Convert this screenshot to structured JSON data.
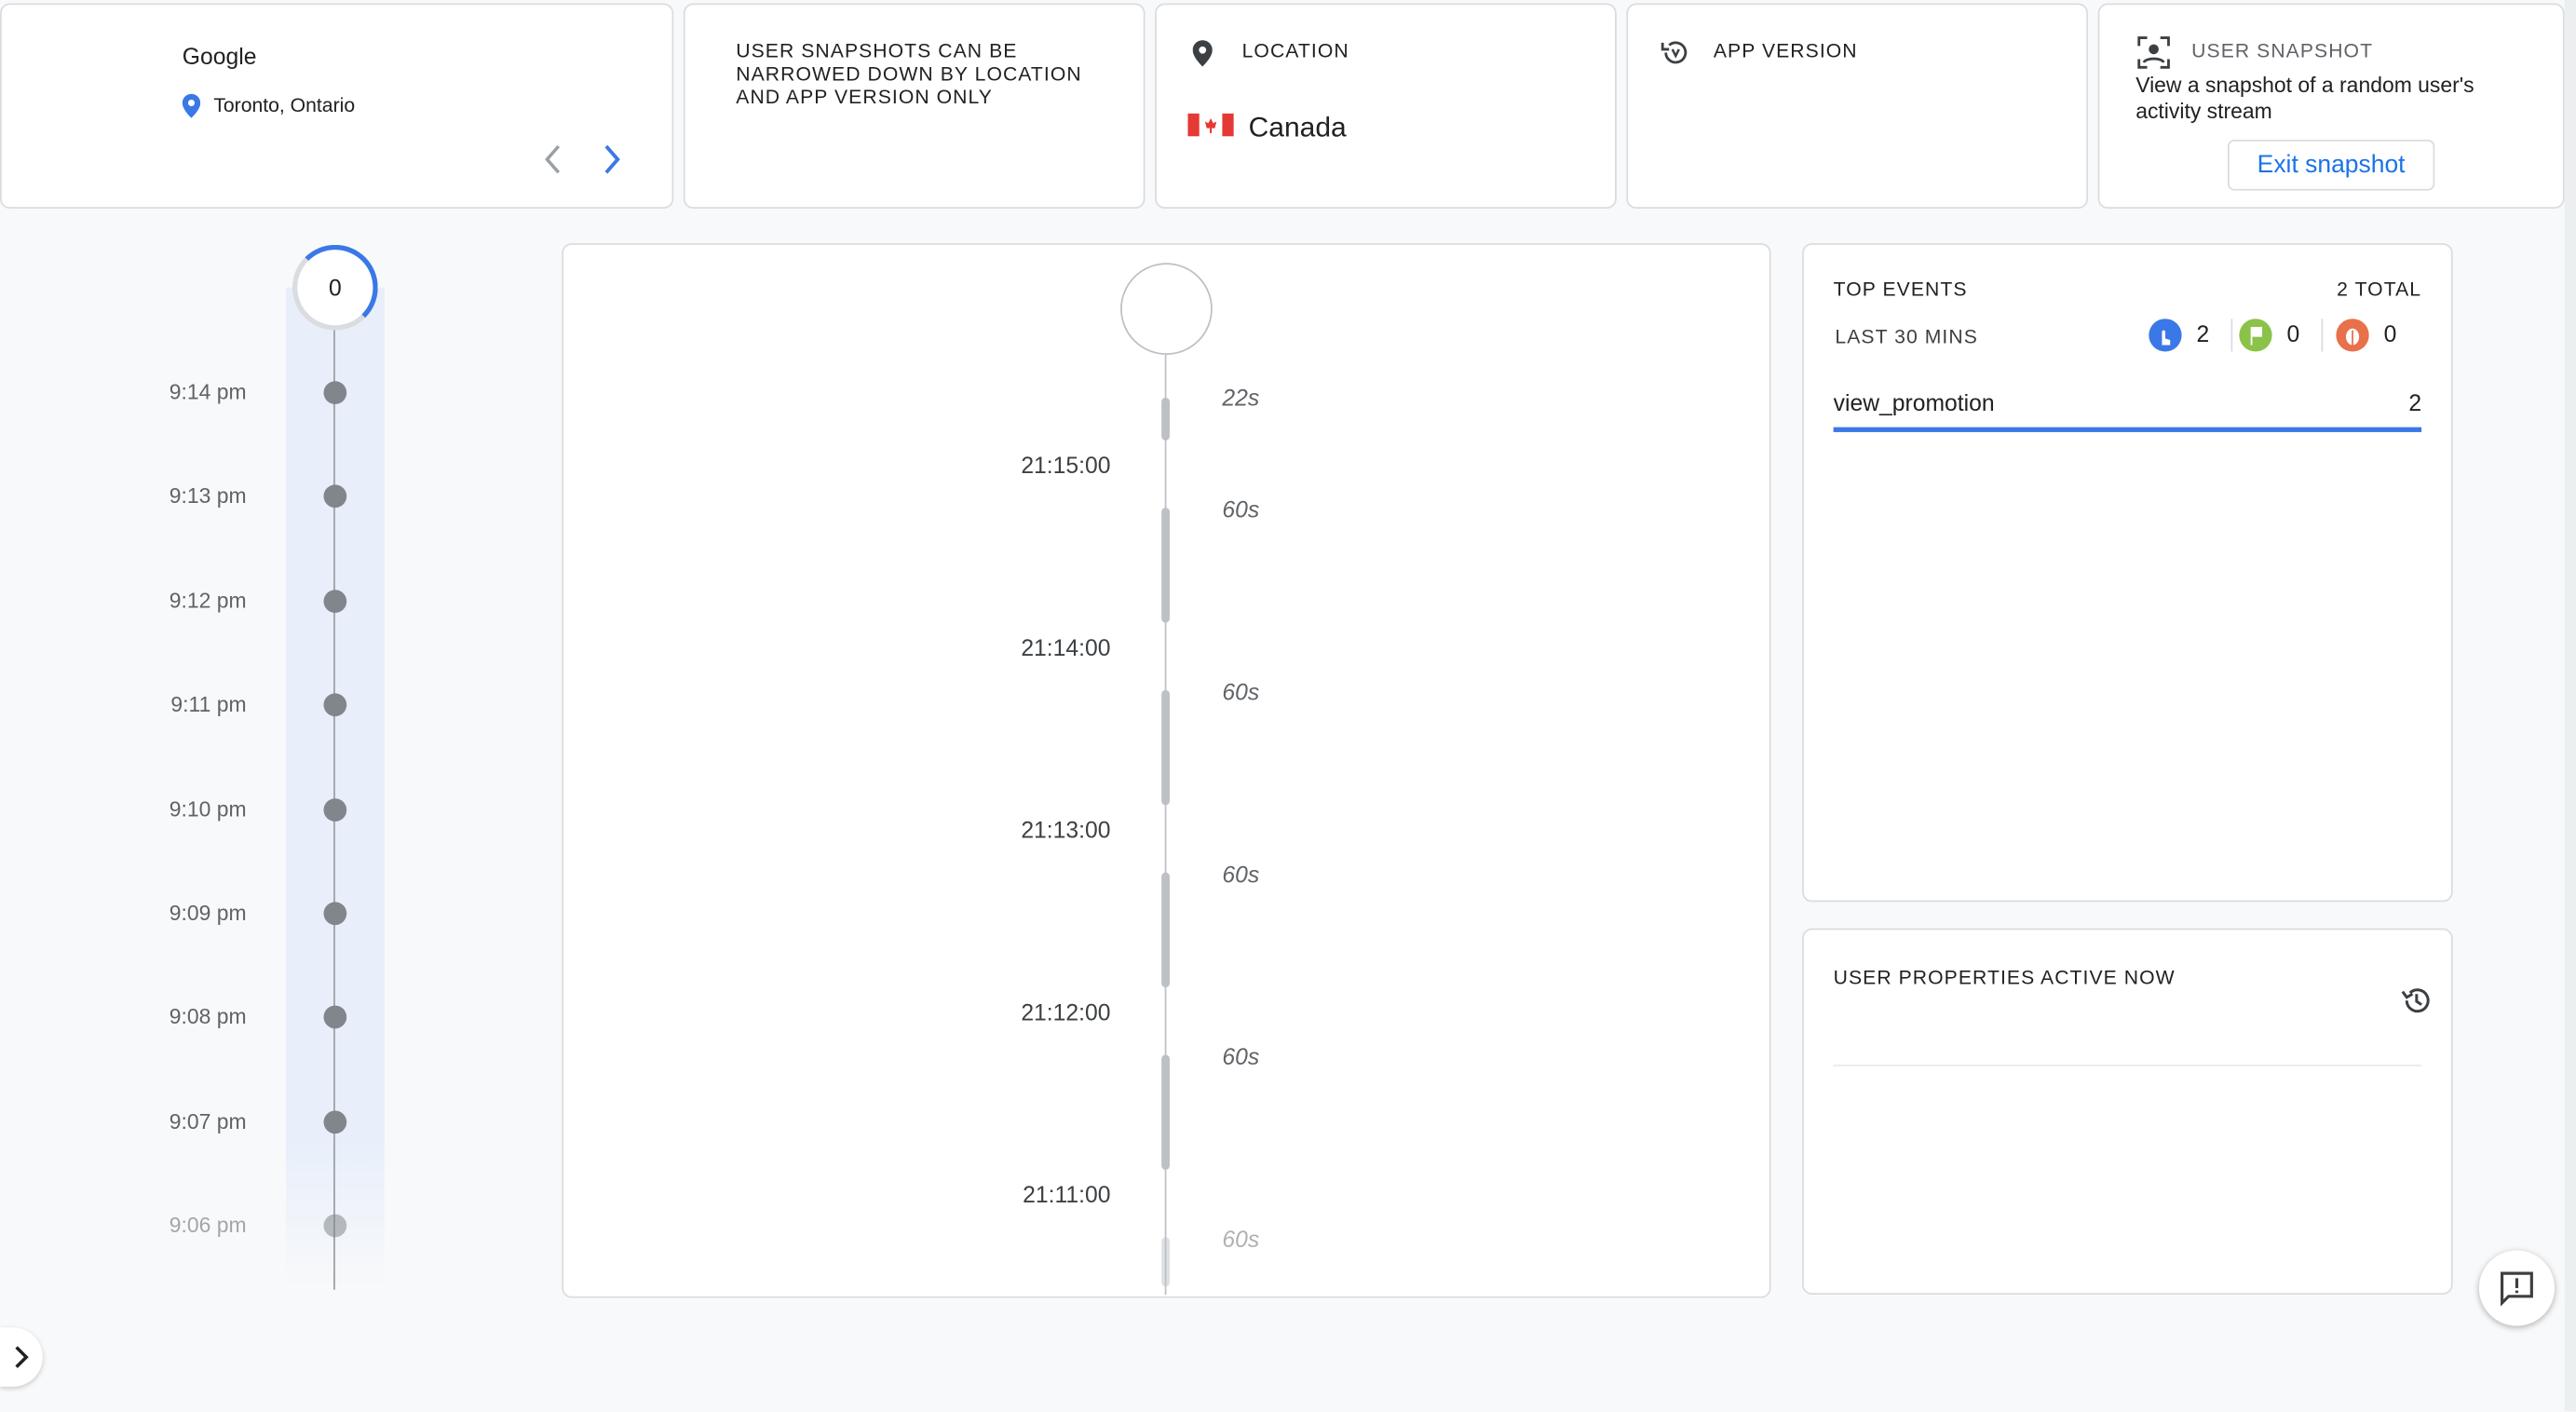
{
  "user_card": {
    "name": "Google",
    "location": "Toronto, Ontario"
  },
  "notice": {
    "text": "USER SNAPSHOTS CAN BE NARROWED DOWN BY LOCATION AND APP VERSION ONLY"
  },
  "location": {
    "label": "LOCATION",
    "value": "Canada"
  },
  "app_version": {
    "label": "APP VERSION"
  },
  "snapshot": {
    "label": "USER SNAPSHOT",
    "description": "View a snapshot of a random user's activity stream",
    "exit_label": "Exit snapshot"
  },
  "minute_timeline": {
    "counter": "0",
    "times": [
      "9:14 pm",
      "9:13 pm",
      "9:12 pm",
      "9:11 pm",
      "9:10 pm",
      "9:09 pm",
      "9:08 pm",
      "9:07 pm",
      "9:06 pm"
    ]
  },
  "stream": {
    "times": [
      "21:15:00",
      "21:14:00",
      "21:13:00",
      "21:12:00",
      "21:11:00"
    ],
    "durations": [
      "22s",
      "60s",
      "60s",
      "60s",
      "60s",
      "60s"
    ]
  },
  "top_events": {
    "title": "TOP EVENTS",
    "total": "2 TOTAL",
    "range": "LAST 30 MINS",
    "counts": [
      {
        "icon": "touch-icon",
        "color": "#3b78e7",
        "value": "2"
      },
      {
        "icon": "flag-icon",
        "color": "#8bc34a",
        "value": "0"
      },
      {
        "icon": "bug-icon",
        "color": "#e8704a",
        "value": "0"
      }
    ],
    "events": [
      {
        "name": "view_promotion",
        "count": "2"
      }
    ]
  },
  "user_properties": {
    "title": "USER PROPERTIES ACTIVE NOW"
  },
  "colors": {
    "accent": "#3b78e7"
  }
}
